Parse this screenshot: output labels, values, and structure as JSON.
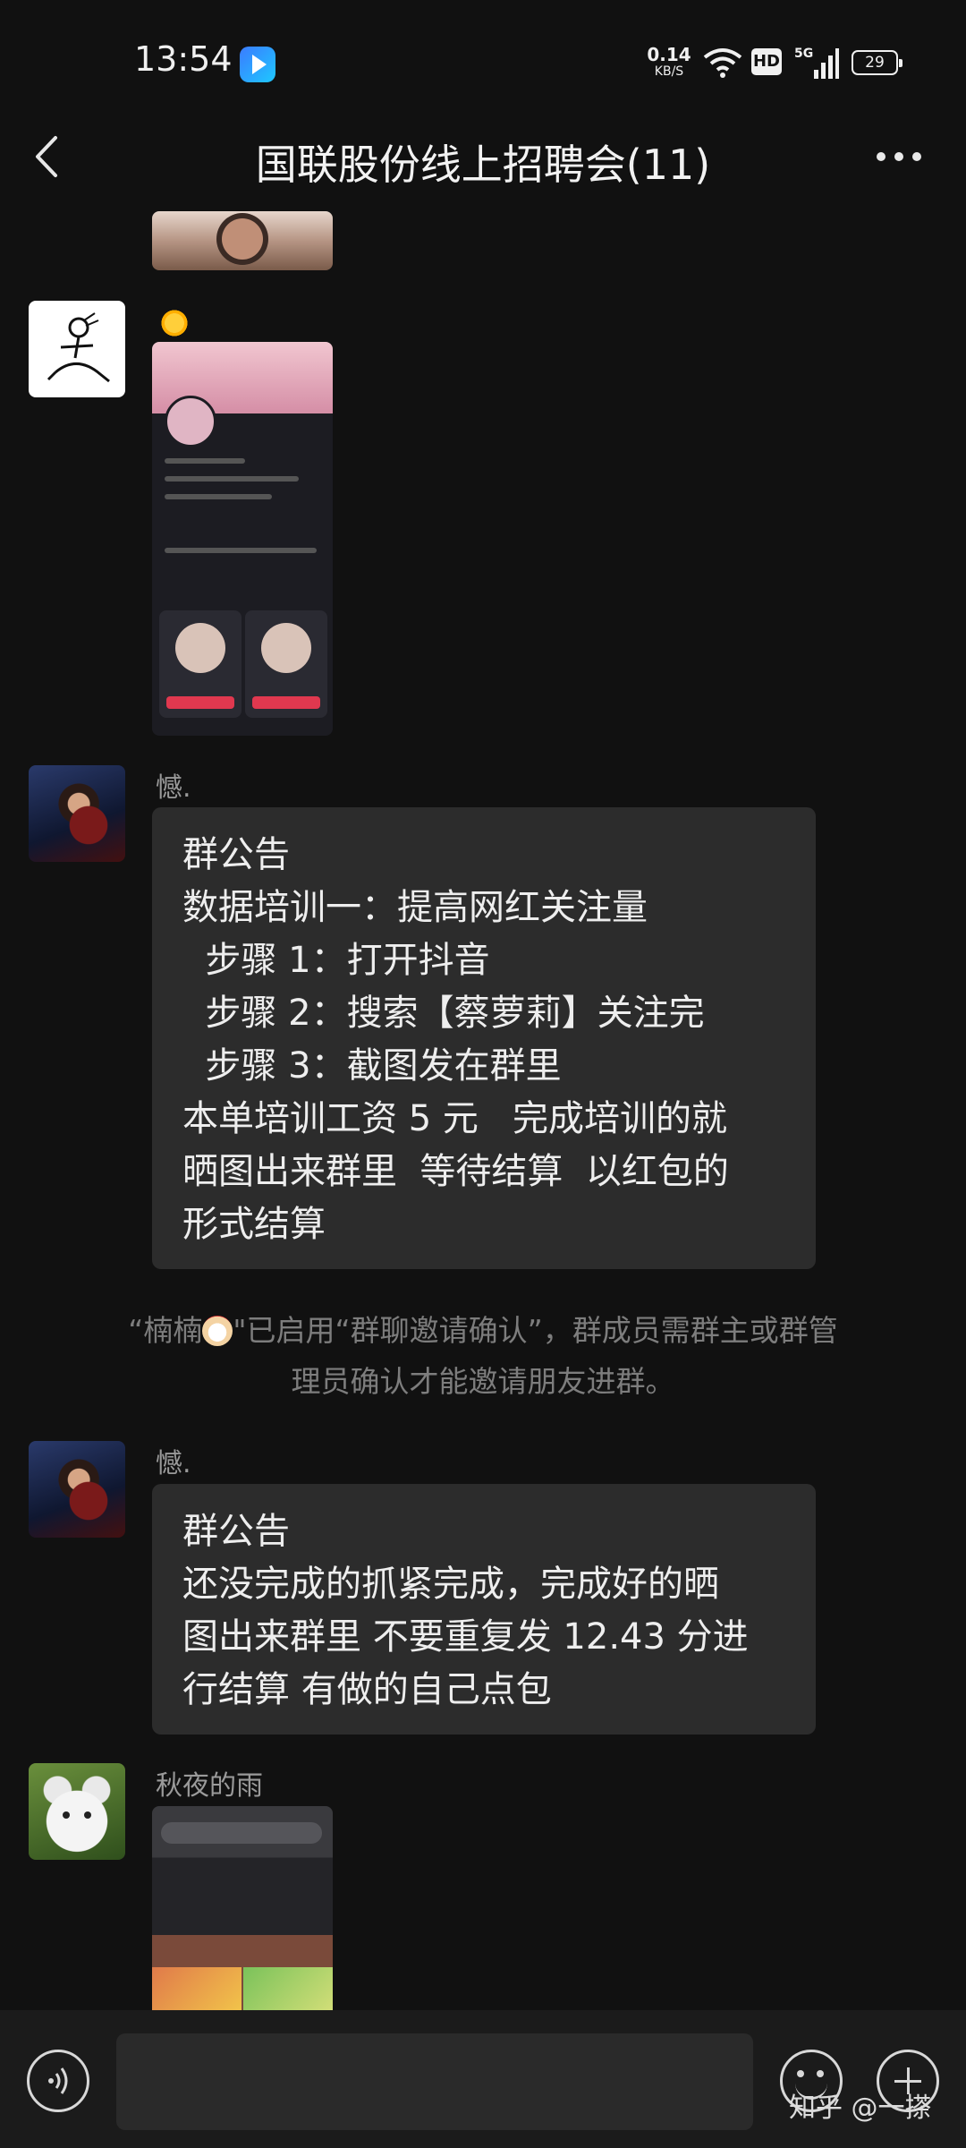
{
  "status_bar": {
    "time": "13:54",
    "net_speed_value": "0.14",
    "net_speed_unit": "KB/S",
    "hd_label": "HD",
    "network_label": "5G",
    "battery_level": "29"
  },
  "header": {
    "title": "国联股份线上招聘会(11)"
  },
  "messages": {
    "m2": {
      "sender": "憾."
    },
    "notice1": {
      "lines": [
        "群公告",
        "数据培训一：提高网红关注量",
        "  步骤 1：打开抖音",
        "  步骤 2：搜索【蔡萝莉】关注完",
        "  步骤 3：截图发在群里",
        "本单培训工资 5 元   完成培训的就",
        "晒图出来群里  等待结算  以红包的",
        "形式结算"
      ]
    },
    "system": {
      "name": "楠楠",
      "line1_suffix": "\"已启用“群聊邀请确认”，群成员需群主或群管",
      "line2": "理员确认才能邀请朋友进群。"
    },
    "m4": {
      "sender": "憾."
    },
    "notice2": {
      "lines": [
        "群公告",
        "还没完成的抓紧完成，完成好的晒",
        "图出来群里 不要重复发 12.43 分进",
        "行结算 有做的自己点包"
      ]
    },
    "m5": {
      "sender": "秋夜的雨"
    }
  },
  "watermark": "知乎 @一搽",
  "icons": {
    "back": "chevron-left-icon",
    "more": "more-icon",
    "voice": "voice-icon",
    "emoji": "emoji-icon",
    "plus": "plus-icon"
  },
  "colors": {
    "background": "#111111",
    "bubble": "#2c2c2c",
    "system_text": "#7d7d7d"
  }
}
